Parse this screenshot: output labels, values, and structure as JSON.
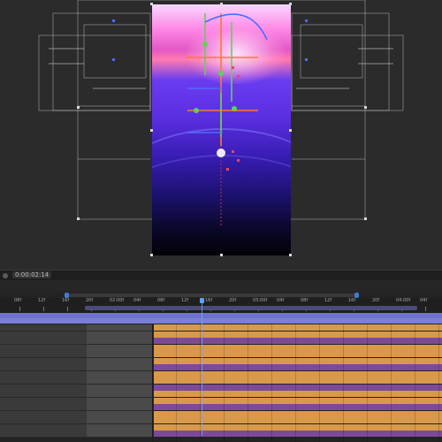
{
  "app": {
    "timecode": "0:00:02:14",
    "accent_color": "#3b7fd6",
    "track_colors": [
      "#d89a4a",
      "#7d4a9a"
    ]
  },
  "timeline": {
    "ruler_labels": [
      "08f",
      "12f",
      "16f",
      "20f",
      "02:00f",
      "04f",
      "08f",
      "12f",
      "16f",
      "20f",
      "03:00f",
      "04f",
      "08f",
      "12f",
      "16f",
      "20f",
      "04:00f",
      "04f"
    ],
    "track_pattern": [
      "orange",
      "orange",
      "purple",
      "orange",
      "orange",
      "orange",
      "purple",
      "orange",
      "orange",
      "purple",
      "orange",
      "orange",
      "purple",
      "orange",
      "orange",
      "orange",
      "purple"
    ]
  }
}
